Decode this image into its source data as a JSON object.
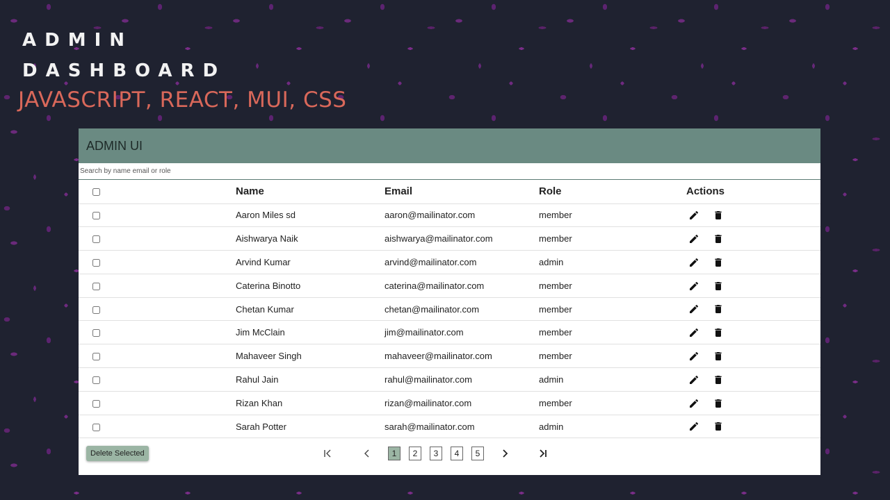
{
  "page": {
    "title_line1": "ADMIN",
    "title_line2": "DASHBOARD",
    "subtitle": "JAVASCRIPT, REACT,  MUI, CSS"
  },
  "app": {
    "title": "ADMIN UI",
    "search_placeholder": "Search by name email or role",
    "columns": {
      "name": "Name",
      "email": "Email",
      "role": "Role",
      "actions": "Actions"
    },
    "rows": [
      {
        "name": "Aaron Miles sd",
        "email": "aaron@mailinator.com",
        "role": "member"
      },
      {
        "name": "Aishwarya Naik",
        "email": "aishwarya@mailinator.com",
        "role": "member"
      },
      {
        "name": "Arvind Kumar",
        "email": "arvind@mailinator.com",
        "role": "admin"
      },
      {
        "name": "Caterina Binotto",
        "email": "caterina@mailinator.com",
        "role": "member"
      },
      {
        "name": "Chetan Kumar",
        "email": "chetan@mailinator.com",
        "role": "member"
      },
      {
        "name": "Jim McClain",
        "email": "jim@mailinator.com",
        "role": "member"
      },
      {
        "name": "Mahaveer Singh",
        "email": "mahaveer@mailinator.com",
        "role": "member"
      },
      {
        "name": "Rahul Jain",
        "email": "rahul@mailinator.com",
        "role": "admin"
      },
      {
        "name": "Rizan Khan",
        "email": "rizan@mailinator.com",
        "role": "member"
      },
      {
        "name": "Sarah Potter",
        "email": "sarah@mailinator.com",
        "role": "admin"
      }
    ],
    "delete_selected_label": "Delete Selected",
    "pagination": {
      "pages": [
        "1",
        "2",
        "3",
        "4",
        "5"
      ],
      "current": "1"
    }
  },
  "colors": {
    "appbar": "#6a8a82",
    "accent": "#9bb5a4",
    "subtitle": "#d9685a",
    "background": "#1f2230",
    "splatter": "#6a2a7a"
  },
  "icons": {
    "edit": "pencil-icon",
    "delete": "trash-icon",
    "first": "first-page-icon",
    "prev": "chevron-left-icon",
    "next": "chevron-right-icon",
    "last": "last-page-icon"
  }
}
